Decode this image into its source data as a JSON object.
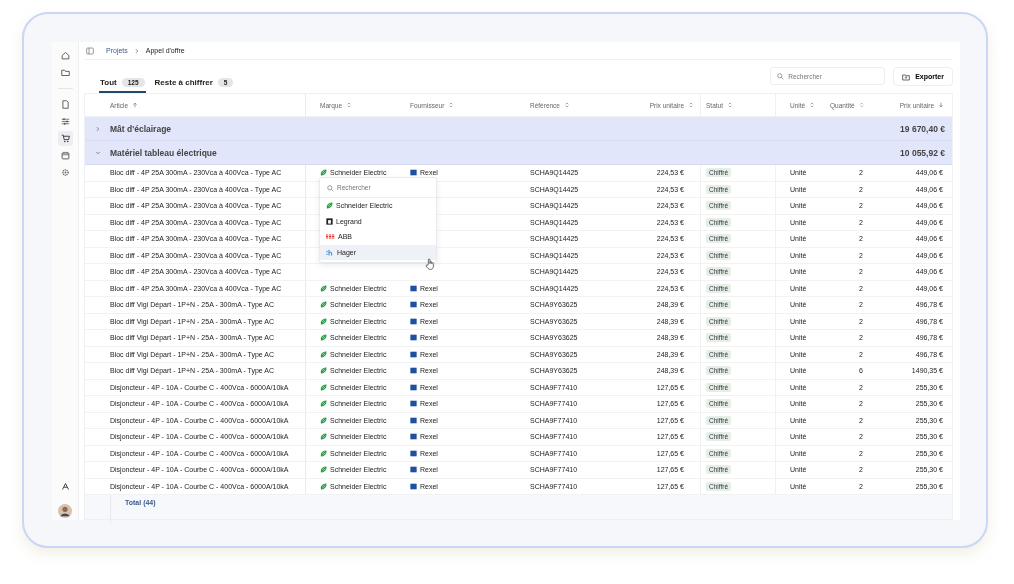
{
  "sidebar": {
    "top": [
      {
        "kind": "home",
        "selected": false
      },
      {
        "kind": "folder",
        "selected": false
      }
    ],
    "items": [
      {
        "kind": "document",
        "selected": false
      },
      {
        "kind": "sliders",
        "selected": false
      },
      {
        "kind": "cart",
        "selected": true
      },
      {
        "kind": "calendar",
        "selected": false
      },
      {
        "kind": "gear",
        "selected": false
      }
    ]
  },
  "breadcrumb": [
    {
      "label": "Projets",
      "current": false
    },
    {
      "label": "Appel d'offre",
      "current": true
    }
  ],
  "tabs": [
    {
      "label": "Tout",
      "count": "125",
      "selected": true
    },
    {
      "label": "Reste à chiffrer",
      "count": "5",
      "selected": false
    }
  ],
  "search": {
    "placeholder": "Rechercher"
  },
  "export_button": "Exporter",
  "columns": [
    {
      "label": "Article",
      "kind": "asc"
    },
    {
      "label": "Marque",
      "kind": "unsorted"
    },
    {
      "label": "Fournisseur",
      "kind": "unsorted"
    },
    {
      "label": "Référence",
      "kind": "unsorted"
    },
    {
      "label": "Prix unitaire",
      "kind": "unsorted"
    },
    {
      "label": "Statut",
      "kind": "unsorted"
    },
    {
      "label": "Unité",
      "kind": "unsorted"
    },
    {
      "label": "Quantité",
      "kind": "unsorted"
    },
    {
      "label": "Prix unitaire",
      "kind": "desc"
    }
  ],
  "groups": [
    {
      "name": "Mât d'éclairage",
      "expanded": false,
      "total": "19 670,40 €"
    },
    {
      "name": "Matériel tableau électrique",
      "expanded": true,
      "total": "10 055,92 €"
    }
  ],
  "rows": [
    {
      "article": "Bloc diff - 4P 25A 300mA - 230Vca à 400Vca - Type AC",
      "brand": "Schneider Electric",
      "supplier": "Rexel",
      "reference": "SCHA9Q14425",
      "unit_price": "224,53 €",
      "status": "Chiffré",
      "unit": "Unité",
      "quantity": "2",
      "total": "449,06 €"
    },
    {
      "article": "Bloc diff - 4P 25A 300mA - 230Vca à 400Vca - Type AC",
      "reference": "SCHA9Q14425",
      "unit_price": "224,53 €",
      "status": "Chiffré",
      "unit": "Unité",
      "quantity": "2",
      "total": "449,06 €"
    },
    {
      "article": "Bloc diff - 4P 25A 300mA - 230Vca à 400Vca - Type AC",
      "reference": "SCHA9Q14425",
      "unit_price": "224,53 €",
      "status": "Chiffré",
      "unit": "Unité",
      "quantity": "2",
      "total": "449,06 €"
    },
    {
      "article": "Bloc diff - 4P 25A 300mA - 230Vca à 400Vca - Type AC",
      "reference": "SCHA9Q14425",
      "unit_price": "224,53 €",
      "status": "Chiffré",
      "unit": "Unité",
      "quantity": "2",
      "total": "449,06 €"
    },
    {
      "article": "Bloc diff - 4P 25A 300mA - 230Vca à 400Vca - Type AC",
      "reference": "SCHA9Q14425",
      "unit_price": "224,53 €",
      "status": "Chiffré",
      "unit": "Unité",
      "quantity": "2",
      "total": "449,06 €"
    },
    {
      "article": "Bloc diff - 4P 25A 300mA - 230Vca à 400Vca - Type AC",
      "reference": "SCHA9Q14425",
      "unit_price": "224,53 €",
      "status": "Chiffré",
      "unit": "Unité",
      "quantity": "2",
      "total": "449,06 €"
    },
    {
      "article": "Bloc diff - 4P 25A 300mA - 230Vca à 400Vca - Type AC",
      "reference": "SCHA9Q14425",
      "unit_price": "224,53 €",
      "status": "Chiffré",
      "unit": "Unité",
      "quantity": "2",
      "total": "449,06 €"
    },
    {
      "article": "Bloc diff - 4P 25A 300mA - 230Vca à 400Vca - Type AC",
      "brand": "Schneider Electric",
      "supplier": "Rexel",
      "reference": "SCHA9Q14425",
      "unit_price": "224,53 €",
      "status": "Chiffré",
      "unit": "Unité",
      "quantity": "2",
      "total": "449,06 €"
    },
    {
      "article": "Bloc diff Vigi Départ - 1P+N - 25A - 300mA - Type AC",
      "brand": "Schneider Electric",
      "supplier": "Rexel",
      "reference": "SCHA9Y63625",
      "unit_price": "248,39 €",
      "status": "Chiffré",
      "unit": "Unité",
      "quantity": "2",
      "total": "496,78 €"
    },
    {
      "article": "Bloc diff Vigi Départ - 1P+N - 25A - 300mA - Type AC",
      "brand": "Schneider Electric",
      "supplier": "Rexel",
      "reference": "SCHA9Y63625",
      "unit_price": "248,39 €",
      "status": "Chiffré",
      "unit": "Unité",
      "quantity": "2",
      "total": "496,78 €"
    },
    {
      "article": "Bloc diff Vigi Départ - 1P+N - 25A - 300mA - Type AC",
      "brand": "Schneider Electric",
      "supplier": "Rexel",
      "reference": "SCHA9Y63625",
      "unit_price": "248,39 €",
      "status": "Chiffré",
      "unit": "Unité",
      "quantity": "2",
      "total": "496,78 €"
    },
    {
      "article": "Bloc diff Vigi Départ - 1P+N - 25A - 300mA - Type AC",
      "brand": "Schneider Electric",
      "supplier": "Rexel",
      "reference": "SCHA9Y63625",
      "unit_price": "248,39 €",
      "status": "Chiffré",
      "unit": "Unité",
      "quantity": "2",
      "total": "496,78 €"
    },
    {
      "article": "Bloc diff Vigi Départ - 1P+N - 25A - 300mA - Type AC",
      "brand": "Schneider Electric",
      "supplier": "Rexel",
      "reference": "SCHA9Y63625",
      "unit_price": "248,39 €",
      "status": "Chiffré",
      "unit": "Unité",
      "quantity": "6",
      "total": "1490,35 €"
    },
    {
      "article": "Disjoncteur - 4P - 10A - Courbe C - 400Vca - 6000A/10kA",
      "brand": "Schneider Electric",
      "supplier": "Rexel",
      "reference": "SCHA9F77410",
      "unit_price": "127,65 €",
      "status": "Chiffré",
      "unit": "Unité",
      "quantity": "2",
      "total": "255,30 €"
    },
    {
      "article": "Disjoncteur - 4P - 10A - Courbe C - 400Vca - 6000A/10kA",
      "brand": "Schneider Electric",
      "supplier": "Rexel",
      "reference": "SCHA9F77410",
      "unit_price": "127,65 €",
      "status": "Chiffré",
      "unit": "Unité",
      "quantity": "2",
      "total": "255,30 €"
    },
    {
      "article": "Disjoncteur - 4P - 10A - Courbe C - 400Vca - 6000A/10kA",
      "brand": "Schneider Electric",
      "supplier": "Rexel",
      "reference": "SCHA9F77410",
      "unit_price": "127,65 €",
      "status": "Chiffré",
      "unit": "Unité",
      "quantity": "2",
      "total": "255,30 €"
    },
    {
      "article": "Disjoncteur - 4P - 10A - Courbe C - 400Vca - 6000A/10kA",
      "brand": "Schneider Electric",
      "supplier": "Rexel",
      "reference": "SCHA9F77410",
      "unit_price": "127,65 €",
      "status": "Chiffré",
      "unit": "Unité",
      "quantity": "2",
      "total": "255,30 €"
    },
    {
      "article": "Disjoncteur - 4P - 10A - Courbe C - 400Vca - 6000A/10kA",
      "brand": "Schneider Electric",
      "supplier": "Rexel",
      "reference": "SCHA9F77410",
      "unit_price": "127,65 €",
      "status": "Chiffré",
      "unit": "Unité",
      "quantity": "2",
      "total": "255,30 €"
    },
    {
      "article": "Disjoncteur - 4P - 10A - Courbe C - 400Vca - 6000A/10kA",
      "brand": "Schneider Electric",
      "supplier": "Rexel",
      "reference": "SCHA9F77410",
      "unit_price": "127,65 €",
      "status": "Chiffré",
      "unit": "Unité",
      "quantity": "2",
      "total": "255,30 €"
    },
    {
      "article": "Disjoncteur - 4P - 10A - Courbe C - 400Vca - 6000A/10kA",
      "brand": "Schneider Electric",
      "supplier": "Rexel",
      "reference": "SCHA9F77410",
      "unit_price": "127,65 €",
      "status": "Chiffré",
      "unit": "Unité",
      "quantity": "2",
      "total": "255,30 €"
    }
  ],
  "total_label": "Total (44)",
  "brand_dropdown": {
    "placeholder": "Rechercher",
    "options": [
      {
        "label": "Schneider Electric",
        "kind": "leaf",
        "highlighted": false
      },
      {
        "label": "Legrand",
        "kind": "square",
        "highlighted": false
      },
      {
        "label": "ABB",
        "kind": "stripes",
        "highlighted": false
      },
      {
        "label": "Hager",
        "kind": "h",
        "highlighted": true
      }
    ]
  }
}
